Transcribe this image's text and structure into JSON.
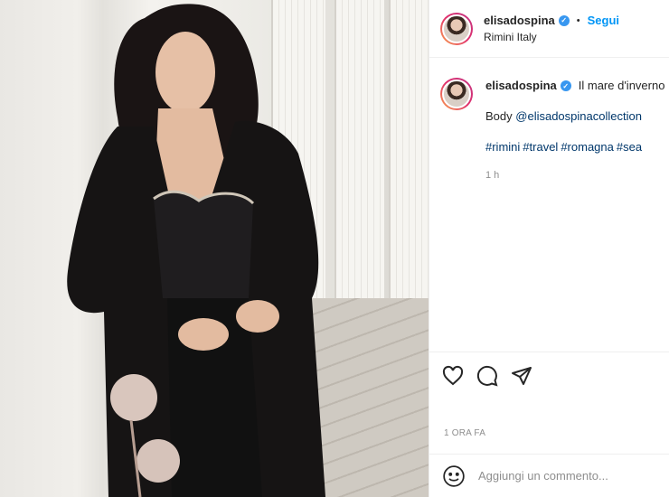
{
  "post": {
    "username": "elisadospina",
    "follow_label": "Segui",
    "dot": "•",
    "location": "Rimini Italy",
    "caption_text": "Il mare d'inverno",
    "body_prefix": "Body",
    "mention": "@elisadospinacollection",
    "hashtags": [
      "#rimini",
      "#travel",
      "#romagna",
      "#sea"
    ],
    "caption_age": "1 h",
    "posted_ago": "1 ORA FA",
    "comment_placeholder": "Aggiungi un commento..."
  },
  "icons": {
    "verified": "verified-badge-icon",
    "like": "heart-icon",
    "comment": "comment-bubble-icon",
    "share": "paper-plane-icon",
    "emoji": "smiley-icon"
  },
  "colors": {
    "follow": "#0095f6",
    "link": "#00376b",
    "verified": "#3897f0",
    "muted": "#8e8e8e"
  }
}
